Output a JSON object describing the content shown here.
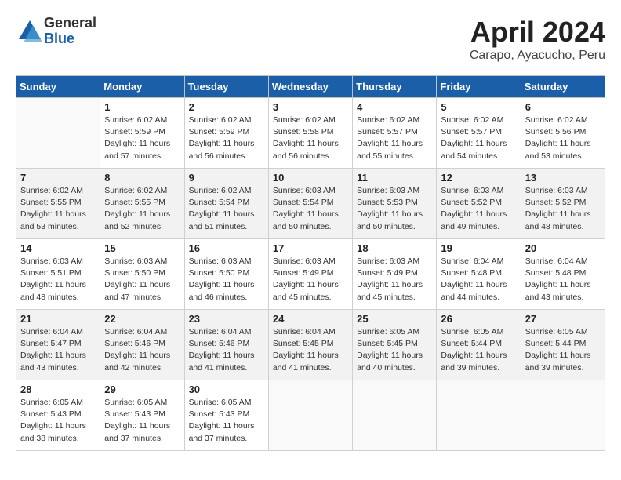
{
  "header": {
    "logo": {
      "general": "General",
      "blue": "Blue"
    },
    "title": "April 2024",
    "location": "Carapo, Ayacucho, Peru"
  },
  "weekdays": [
    "Sunday",
    "Monday",
    "Tuesday",
    "Wednesday",
    "Thursday",
    "Friday",
    "Saturday"
  ],
  "weeks": [
    [
      {
        "day": "",
        "info": ""
      },
      {
        "day": "1",
        "info": "Sunrise: 6:02 AM\nSunset: 5:59 PM\nDaylight: 11 hours\nand 57 minutes."
      },
      {
        "day": "2",
        "info": "Sunrise: 6:02 AM\nSunset: 5:59 PM\nDaylight: 11 hours\nand 56 minutes."
      },
      {
        "day": "3",
        "info": "Sunrise: 6:02 AM\nSunset: 5:58 PM\nDaylight: 11 hours\nand 56 minutes."
      },
      {
        "day": "4",
        "info": "Sunrise: 6:02 AM\nSunset: 5:57 PM\nDaylight: 11 hours\nand 55 minutes."
      },
      {
        "day": "5",
        "info": "Sunrise: 6:02 AM\nSunset: 5:57 PM\nDaylight: 11 hours\nand 54 minutes."
      },
      {
        "day": "6",
        "info": "Sunrise: 6:02 AM\nSunset: 5:56 PM\nDaylight: 11 hours\nand 53 minutes."
      }
    ],
    [
      {
        "day": "7",
        "info": "Sunrise: 6:02 AM\nSunset: 5:55 PM\nDaylight: 11 hours\nand 53 minutes."
      },
      {
        "day": "8",
        "info": "Sunrise: 6:02 AM\nSunset: 5:55 PM\nDaylight: 11 hours\nand 52 minutes."
      },
      {
        "day": "9",
        "info": "Sunrise: 6:02 AM\nSunset: 5:54 PM\nDaylight: 11 hours\nand 51 minutes."
      },
      {
        "day": "10",
        "info": "Sunrise: 6:03 AM\nSunset: 5:54 PM\nDaylight: 11 hours\nand 50 minutes."
      },
      {
        "day": "11",
        "info": "Sunrise: 6:03 AM\nSunset: 5:53 PM\nDaylight: 11 hours\nand 50 minutes."
      },
      {
        "day": "12",
        "info": "Sunrise: 6:03 AM\nSunset: 5:52 PM\nDaylight: 11 hours\nand 49 minutes."
      },
      {
        "day": "13",
        "info": "Sunrise: 6:03 AM\nSunset: 5:52 PM\nDaylight: 11 hours\nand 48 minutes."
      }
    ],
    [
      {
        "day": "14",
        "info": "Sunrise: 6:03 AM\nSunset: 5:51 PM\nDaylight: 11 hours\nand 48 minutes."
      },
      {
        "day": "15",
        "info": "Sunrise: 6:03 AM\nSunset: 5:50 PM\nDaylight: 11 hours\nand 47 minutes."
      },
      {
        "day": "16",
        "info": "Sunrise: 6:03 AM\nSunset: 5:50 PM\nDaylight: 11 hours\nand 46 minutes."
      },
      {
        "day": "17",
        "info": "Sunrise: 6:03 AM\nSunset: 5:49 PM\nDaylight: 11 hours\nand 45 minutes."
      },
      {
        "day": "18",
        "info": "Sunrise: 6:03 AM\nSunset: 5:49 PM\nDaylight: 11 hours\nand 45 minutes."
      },
      {
        "day": "19",
        "info": "Sunrise: 6:04 AM\nSunset: 5:48 PM\nDaylight: 11 hours\nand 44 minutes."
      },
      {
        "day": "20",
        "info": "Sunrise: 6:04 AM\nSunset: 5:48 PM\nDaylight: 11 hours\nand 43 minutes."
      }
    ],
    [
      {
        "day": "21",
        "info": "Sunrise: 6:04 AM\nSunset: 5:47 PM\nDaylight: 11 hours\nand 43 minutes."
      },
      {
        "day": "22",
        "info": "Sunrise: 6:04 AM\nSunset: 5:46 PM\nDaylight: 11 hours\nand 42 minutes."
      },
      {
        "day": "23",
        "info": "Sunrise: 6:04 AM\nSunset: 5:46 PM\nDaylight: 11 hours\nand 41 minutes."
      },
      {
        "day": "24",
        "info": "Sunrise: 6:04 AM\nSunset: 5:45 PM\nDaylight: 11 hours\nand 41 minutes."
      },
      {
        "day": "25",
        "info": "Sunrise: 6:05 AM\nSunset: 5:45 PM\nDaylight: 11 hours\nand 40 minutes."
      },
      {
        "day": "26",
        "info": "Sunrise: 6:05 AM\nSunset: 5:44 PM\nDaylight: 11 hours\nand 39 minutes."
      },
      {
        "day": "27",
        "info": "Sunrise: 6:05 AM\nSunset: 5:44 PM\nDaylight: 11 hours\nand 39 minutes."
      }
    ],
    [
      {
        "day": "28",
        "info": "Sunrise: 6:05 AM\nSunset: 5:43 PM\nDaylight: 11 hours\nand 38 minutes."
      },
      {
        "day": "29",
        "info": "Sunrise: 6:05 AM\nSunset: 5:43 PM\nDaylight: 11 hours\nand 37 minutes."
      },
      {
        "day": "30",
        "info": "Sunrise: 6:05 AM\nSunset: 5:43 PM\nDaylight: 11 hours\nand 37 minutes."
      },
      {
        "day": "",
        "info": ""
      },
      {
        "day": "",
        "info": ""
      },
      {
        "day": "",
        "info": ""
      },
      {
        "day": "",
        "info": ""
      }
    ]
  ]
}
